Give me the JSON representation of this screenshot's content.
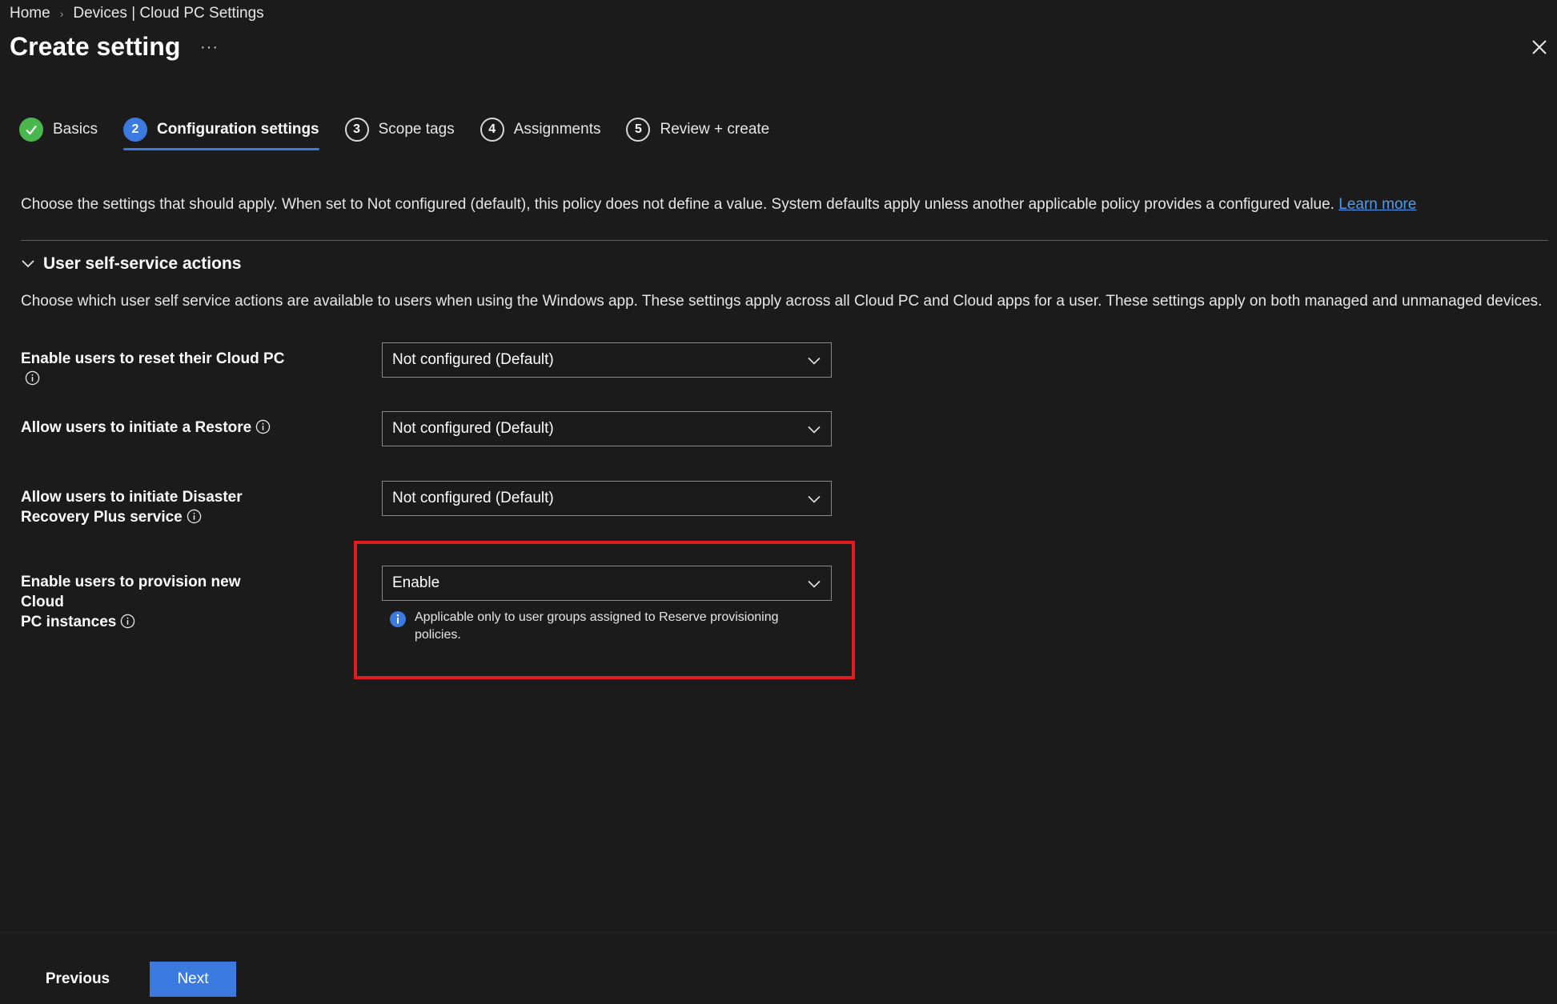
{
  "breadcrumb": {
    "home": "Home",
    "separator": "›",
    "current": "Devices | Cloud PC Settings"
  },
  "header": {
    "title": "Create setting",
    "more": "···",
    "close_icon": "close-icon"
  },
  "tabs": [
    {
      "number": "✓",
      "label": "Basics",
      "state": "done"
    },
    {
      "number": "2",
      "label": "Configuration settings",
      "state": "active"
    },
    {
      "number": "3",
      "label": "Scope tags",
      "state": "pending"
    },
    {
      "number": "4",
      "label": "Assignments",
      "state": "pending"
    },
    {
      "number": "5",
      "label": "Review + create",
      "state": "pending"
    }
  ],
  "intro": {
    "text": "Choose the settings that should apply. When set to Not configured (default), this policy does not define a value. System defaults apply unless another applicable policy provides a configured value. ",
    "link": "Learn more"
  },
  "section": {
    "title": "User self-service actions",
    "description": "Choose which user self service actions are available to users when using the Windows app. These settings apply across all Cloud PC and Cloud apps for a user. These settings apply on both managed and unmanaged devices."
  },
  "settings": [
    {
      "label": "Enable users to reset their Cloud PC",
      "value": "Not configured (Default)"
    },
    {
      "label": "Allow users to initiate a Restore",
      "value": "Not configured (Default)"
    },
    {
      "label_line1": "Allow users to initiate Disaster",
      "label_line2": "Recovery Plus service",
      "value": "Not configured (Default)"
    },
    {
      "label_line1": "Enable users to provision new Cloud",
      "label_line2": "PC instances",
      "value": "Enable"
    }
  ],
  "note": {
    "text_line1": "Applicable only to user groups assigned to Reserve provisioning",
    "text_line2": "policies."
  },
  "footer": {
    "previous": "Previous",
    "next": "Next"
  },
  "colors": {
    "accent": "#3c7ae0",
    "success": "#4ab74e",
    "highlight": "#e01b22",
    "link": "#4d9cf0",
    "background": "#1b1b1b"
  }
}
